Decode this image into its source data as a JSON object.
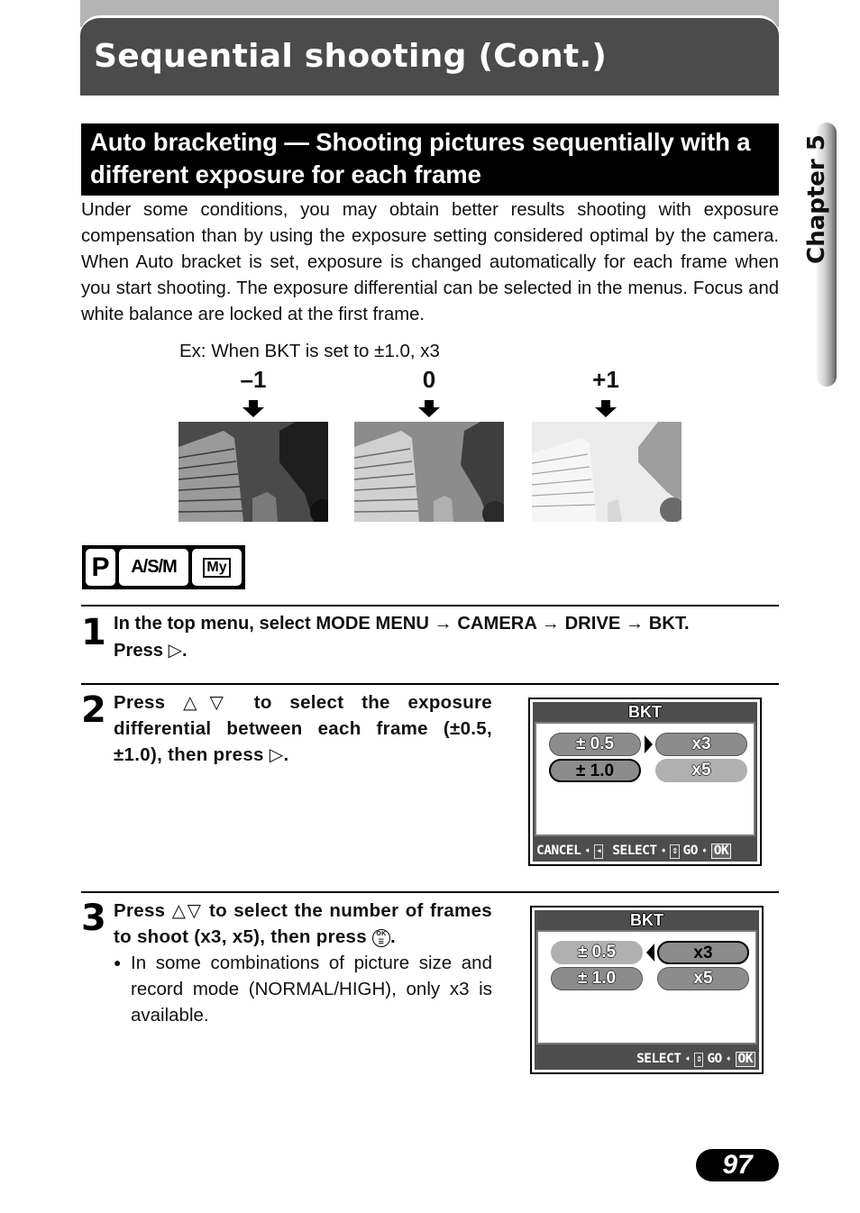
{
  "header": {
    "title": "Sequential shooting (Cont.)"
  },
  "chapter_tab": {
    "label": "Chapter 5"
  },
  "section": {
    "heading": "Auto bracketing — Shooting pictures sequentially with a different exposure for each frame",
    "intro": "Under some conditions, you may obtain better results shooting with exposure compensation than by using the exposure setting considered optimal by the camera. When Auto bracket is set, exposure is changed automatically for each frame when you start shooting. The exposure differential can be selected in the menus. Focus and white balance are locked at the first frame."
  },
  "example": {
    "caption": "Ex: When BKT is set to ±1.0, x3",
    "frames": [
      {
        "label": "–1",
        "image": "dark-buildings-photo",
        "brightness": "underexposed"
      },
      {
        "label": "0",
        "image": "normal-buildings-photo",
        "brightness": "normal"
      },
      {
        "label": "+1",
        "image": "bright-buildings-photo",
        "brightness": "overexposed"
      }
    ]
  },
  "mode_icons": [
    "P",
    "A/S/M",
    "My"
  ],
  "steps": [
    {
      "number": "1",
      "text": "In the top menu, select MODE MENU → CAMERA → DRIVE → BKT.",
      "text2": "Press",
      "text2_symbol": "▷",
      "text2_end": "."
    },
    {
      "number": "2",
      "prefix": "Press",
      "symbols": "△▽",
      "text": "to select the exposure differential between each frame (±0.5, ±1.0), then press",
      "end_symbol": "▷",
      "end": "."
    },
    {
      "number": "3",
      "prefix": "Press",
      "symbols": "△▽",
      "text": "to select the number of frames to shoot (x3, x5), then press",
      "end_symbol": "OK-button-icon",
      "end": ".",
      "note_bullet": "●",
      "note": "In some combinations of picture size and record mode (NORMAL/HIGH), only x3 is available."
    }
  ],
  "lcd_screens": [
    {
      "title": "BKT",
      "left_options": [
        "± 0.5",
        "± 1.0"
      ],
      "right_options": [
        "x3",
        "x5"
      ],
      "selected_left": "± 1.0",
      "pointer": "▶",
      "footer": {
        "cancel": "CANCEL",
        "select": "SELECT",
        "go": "GO",
        "ok": "OK"
      }
    },
    {
      "title": "BKT",
      "left_options": [
        "± 0.5",
        "± 1.0"
      ],
      "right_options": [
        "x3",
        "x5"
      ],
      "selected_right": "x3",
      "pointer": "◀",
      "footer": {
        "select": "SELECT",
        "go": "GO",
        "ok": "OK"
      }
    }
  ],
  "page_number": "97"
}
